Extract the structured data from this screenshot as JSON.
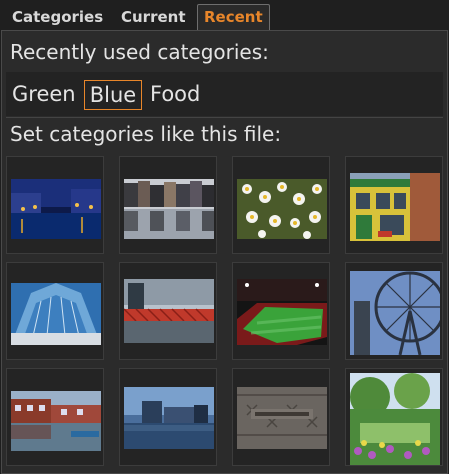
{
  "tabs": [
    {
      "label": "Categories"
    },
    {
      "label": "Current"
    },
    {
      "label": "Recent",
      "active": true
    }
  ],
  "recent": {
    "heading": "Recently used categories:",
    "categories": [
      {
        "label": "Green"
      },
      {
        "label": "Blue",
        "selected": true
      },
      {
        "label": "Food"
      }
    ]
  },
  "similar": {
    "heading": "Set categories like this file:",
    "thumbnails": [
      {
        "icon": "canal-night-photo"
      },
      {
        "icon": "canal-houses-photo"
      },
      {
        "icon": "daisies-photo"
      },
      {
        "icon": "pub-photo"
      },
      {
        "icon": "glass-building-photo"
      },
      {
        "icon": "red-bridge-photo"
      },
      {
        "icon": "stadium-photo"
      },
      {
        "icon": "ferris-wheel-photo"
      },
      {
        "icon": "canal-brick-photo"
      },
      {
        "icon": "media-city-photo"
      },
      {
        "icon": "manhole-cover-photo"
      },
      {
        "icon": "garden-photo"
      }
    ]
  },
  "colors": {
    "accent": "#e8862a",
    "background": "#2b2b2b"
  }
}
